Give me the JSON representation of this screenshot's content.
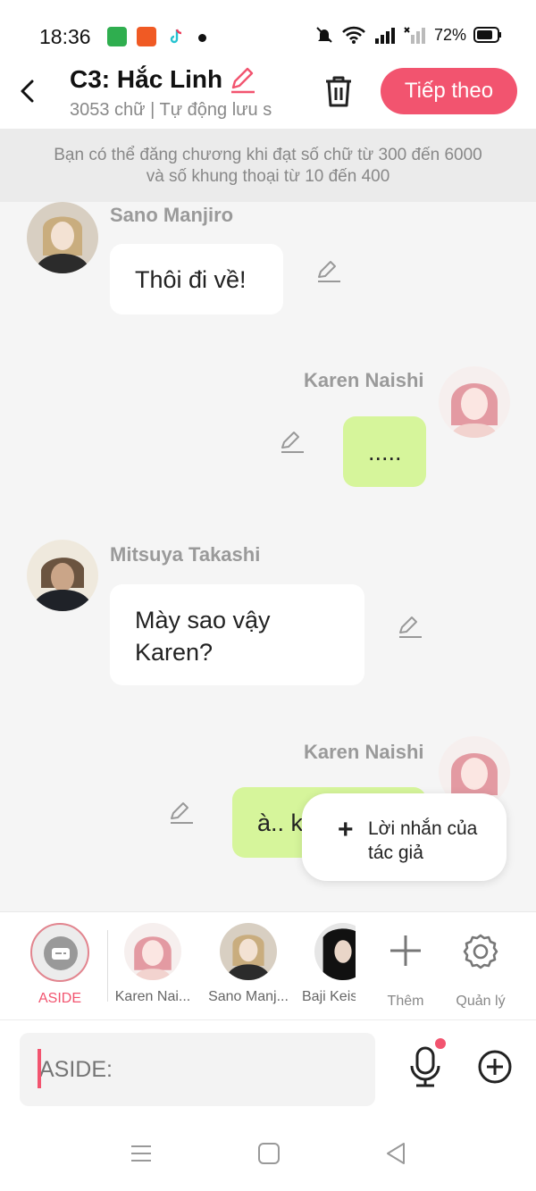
{
  "status_bar": {
    "time": "18:36",
    "battery": "72%",
    "icons": [
      "app-icon-green",
      "app-icon-orange",
      "tiktok-icon",
      "bell-off-icon",
      "wifi-icon",
      "signal-icon",
      "signal-x-icon",
      "battery-icon"
    ]
  },
  "header": {
    "title": "C3: Hắc Linh",
    "subtitle": "3053 chữ | Tự động lưu s",
    "next_label": "Tiếp theo"
  },
  "notice": "Bạn có thể đăng chương khi đạt số chữ từ 300 đến 6000 và số khung thoại từ 10 đến 400",
  "messages": [
    {
      "speaker": "Sano Manjiro",
      "text": "Thôi đi về!",
      "side": "left"
    },
    {
      "speaker": "Karen Naishi",
      "text": ".....",
      "side": "right"
    },
    {
      "speaker": "Mitsuya Takashi",
      "text": "Mày sao vậy Karen?",
      "side": "left"
    },
    {
      "speaker": "Karen Naishi",
      "text": "à.. k",
      "side": "right"
    }
  ],
  "popup": {
    "label": "Lời nhắn của tác giả"
  },
  "characters": {
    "aside_label": "ASIDE",
    "items": [
      "Karen Nai...",
      "Sano Manj...",
      "Baji Keis"
    ],
    "add_label": "Thêm",
    "manage_label": "Quản lý"
  },
  "input": {
    "placeholder": "ASIDE:"
  },
  "colors": {
    "accent": "#f2546f",
    "bubble_right": "#d6f59b",
    "bubble_left": "#ffffff",
    "chat_bg": "#f5f5f5"
  }
}
